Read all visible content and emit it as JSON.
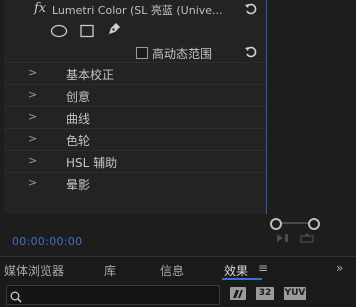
{
  "effect_panel": {
    "fx_label": "fx",
    "effect_name": "Lumetri Color (SL 亮蓝 (Unive...",
    "icons": {
      "reset": "reset-icon",
      "ellipse_mask": "ellipse-mask-icon",
      "rect_mask": "rectangle-mask-icon",
      "pen_mask": "pen-mask-icon"
    },
    "hdr_checkbox": {
      "label": "高动态范围",
      "checked": false
    },
    "sections": [
      {
        "label": "基本校正"
      },
      {
        "label": "创意"
      },
      {
        "label": "曲线"
      },
      {
        "label": "色轮"
      },
      {
        "label": "HSL 辅助"
      },
      {
        "label": "晕影"
      }
    ]
  },
  "timeline": {
    "timecode": "00:00:00:00"
  },
  "tabs": [
    {
      "label": "媒体浏览器"
    },
    {
      "label": "库"
    },
    {
      "label": "信息"
    },
    {
      "label": "效果",
      "active": true
    }
  ],
  "search": {
    "value": "",
    "badges": [
      "32",
      "YUV"
    ]
  },
  "colors": {
    "accent": "#3d6fd0",
    "panel": "#232323",
    "background": "#1d1d1d"
  }
}
